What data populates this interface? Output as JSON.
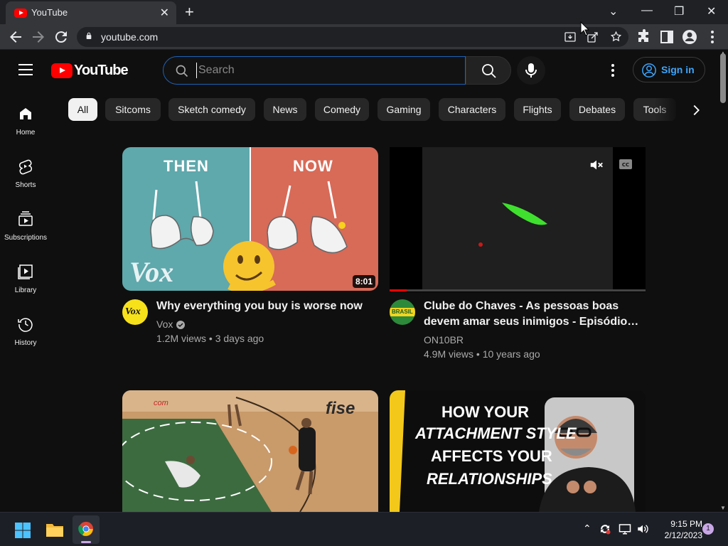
{
  "browser": {
    "tab_title": "YouTube",
    "url": "youtube.com"
  },
  "header": {
    "logo_text": "YouTube",
    "search_placeholder": "Search",
    "signin_label": "Sign in"
  },
  "sidebar": {
    "items": [
      {
        "label": "Home",
        "icon": "home-icon"
      },
      {
        "label": "Shorts",
        "icon": "shorts-icon"
      },
      {
        "label": "Subscriptions",
        "icon": "subscriptions-icon"
      },
      {
        "label": "Library",
        "icon": "library-icon"
      },
      {
        "label": "History",
        "icon": "history-icon"
      }
    ]
  },
  "chips": [
    "All",
    "Sitcoms",
    "Sketch comedy",
    "News",
    "Comedy",
    "Gaming",
    "Characters",
    "Flights",
    "Debates",
    "Tools"
  ],
  "videos": [
    {
      "title": "Why everything you buy is worse now",
      "channel": "Vox",
      "views": "1.2M views",
      "age": "3 days ago",
      "duration": "8:01",
      "thumb_text_left": "THEN",
      "thumb_text_right": "NOW",
      "thumb_watermark": "Vox"
    },
    {
      "title_line1": "Clube do Chaves - As pessoas boas",
      "title_line2": "devem amar seus inimigos - Episódio…",
      "channel": "ON10BR",
      "views": "4.9M views",
      "age": "10 years ago",
      "avatar_text": "BRASIL"
    },
    {
      "thumb_text": "fise",
      "thumb_text_small": "com"
    },
    {
      "thumb_lines": [
        "HOW YOUR",
        "ATTACHMENT STYLE",
        "AFFECTS YOUR",
        "RELATIONSHIPS"
      ]
    }
  ],
  "taskbar": {
    "time": "9:15 PM",
    "date": "2/12/2023",
    "notification_count": "1"
  },
  "colors": {
    "yt_red": "#ff0000",
    "link_blue": "#3ea6ff",
    "background": "#0f0f0f"
  }
}
